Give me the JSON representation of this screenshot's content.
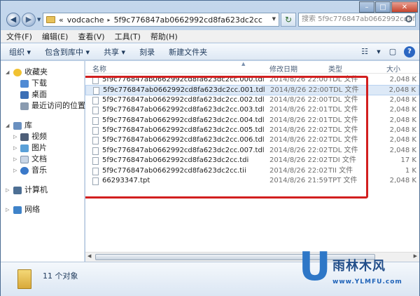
{
  "address": {
    "crumb_prefix": "«",
    "crumb1": "vodcache",
    "crumb_sep": "▸",
    "crumb2": "5f9c776847ab0662992cd8fa623dc2cc",
    "search_placeholder": "搜索 5f9c776847ab0662992cd8fa6..."
  },
  "menu": [
    "文件(F)",
    "编辑(E)",
    "查看(V)",
    "工具(T)",
    "帮助(H)"
  ],
  "toolbar": [
    "组织 ▾",
    "包含到库中 ▾",
    "共享 ▾",
    "刻录",
    "新建文件夹"
  ],
  "nav": {
    "favorites": "收藏夹",
    "downloads": "下载",
    "desktop": "桌面",
    "recent": "最近访问的位置",
    "libraries": "库",
    "videos": "视频",
    "pictures": "图片",
    "documents": "文档",
    "music": "音乐",
    "computer": "计算机",
    "network": "网络"
  },
  "columns": {
    "name": "名称",
    "date": "修改日期",
    "type": "类型",
    "size": "大小"
  },
  "files": [
    {
      "name": "5f9c776847ab0662992cd8fa623dc2cc.000.tdl",
      "date": "2014/8/26 22:00",
      "type": "TDL 文件",
      "size": "2,048 K"
    },
    {
      "name": "5f9c776847ab0662992cd8fa623dc2cc.001.tdl",
      "date": "2014/8/26 22:00",
      "type": "TDL 文件",
      "size": "2,048 K"
    },
    {
      "name": "5f9c776847ab0662992cd8fa623dc2cc.002.tdl",
      "date": "2014/8/26 22:00",
      "type": "TDL 文件",
      "size": "2,048 K"
    },
    {
      "name": "5f9c776847ab0662992cd8fa623dc2cc.003.tdl",
      "date": "2014/8/26 22:01",
      "type": "TDL 文件",
      "size": "2,048 K"
    },
    {
      "name": "5f9c776847ab0662992cd8fa623dc2cc.004.tdl",
      "date": "2014/8/26 22:01",
      "type": "TDL 文件",
      "size": "2,048 K"
    },
    {
      "name": "5f9c776847ab0662992cd8fa623dc2cc.005.tdl",
      "date": "2014/8/26 22:02",
      "type": "TDL 文件",
      "size": "2,048 K"
    },
    {
      "name": "5f9c776847ab0662992cd8fa623dc2cc.006.tdl",
      "date": "2014/8/26 22:02",
      "type": "TDL 文件",
      "size": "2,048 K"
    },
    {
      "name": "5f9c776847ab0662992cd8fa623dc2cc.007.tdl",
      "date": "2014/8/26 22:02",
      "type": "TDL 文件",
      "size": "2,048 K"
    },
    {
      "name": "5f9c776847ab0662992cd8fa623dc2cc.tdi",
      "date": "2014/8/26 22:02",
      "type": "TDI 文件",
      "size": "17 K"
    },
    {
      "name": "5f9c776847ab0662992cd8fa623dc2cc.tii",
      "date": "2014/8/26 22:02",
      "type": "TII 文件",
      "size": "1 K"
    },
    {
      "name": "66293347.tpt",
      "date": "2014/8/26 21:59",
      "type": "TPT 文件",
      "size": "2,048 K"
    }
  ],
  "status": {
    "count": "11 个对象"
  },
  "watermark": {
    "letter": "U",
    "text": "雨林木风",
    "url": "www.YLMFU.com"
  },
  "colors": {
    "highlight": "#d21f1f",
    "selected_row": "#dde9f7",
    "accent": "#2e77c7"
  }
}
